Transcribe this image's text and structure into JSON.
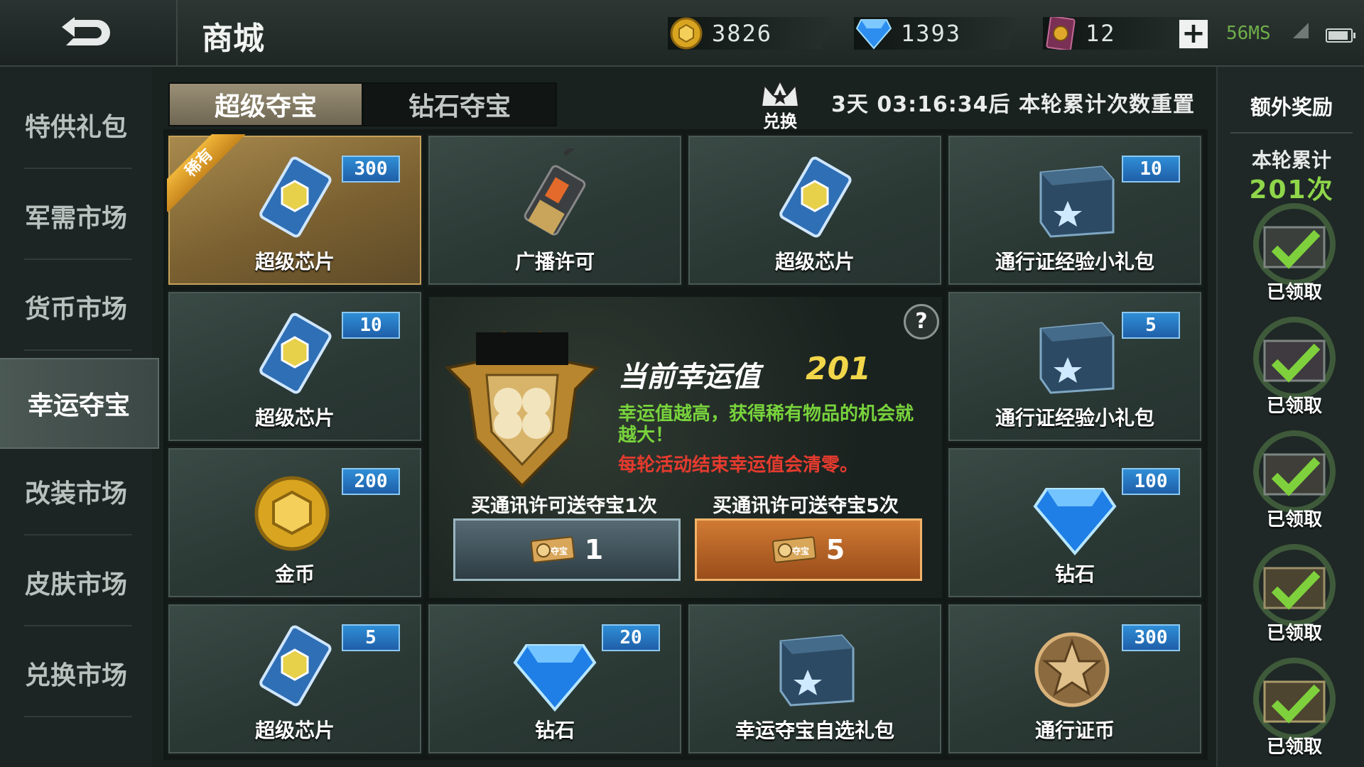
{
  "header": {
    "title": "商城",
    "gold": "3826",
    "diamonds": "1393",
    "passes": "12",
    "ping": "56MS"
  },
  "battery_level": 0.9,
  "sidebar": {
    "items": [
      {
        "label": "特供礼包"
      },
      {
        "label": "军需市场"
      },
      {
        "label": "货币市场"
      },
      {
        "label": "幸运夺宝"
      },
      {
        "label": "改装市场"
      },
      {
        "label": "皮肤市场"
      },
      {
        "label": "兑换市场"
      }
    ]
  },
  "tabs": {
    "super": "超级夺宝",
    "diamond": "钻石夺宝"
  },
  "exchange_label": "兑换",
  "reset_text": "3天 03:16:34后 本轮累计次数重置",
  "items": [
    {
      "name": "超级芯片",
      "count": "300",
      "rare": "稀有"
    },
    {
      "name": "广播许可",
      "count": ""
    },
    {
      "name": "超级芯片",
      "count": ""
    },
    {
      "name": "通行证经验小礼包",
      "count": "10"
    },
    {
      "name": "超级芯片",
      "count": "10"
    },
    {
      "name": "通行证经验小礼包",
      "count": "5"
    },
    {
      "name": "金币",
      "count": "200"
    },
    {
      "name": "钻石",
      "count": "100"
    },
    {
      "name": "超级芯片",
      "count": "5"
    },
    {
      "name": "钻石",
      "count": "20"
    },
    {
      "name": "幸运夺宝自选礼包",
      "count": ""
    },
    {
      "name": "通行证币",
      "count": "300"
    }
  ],
  "lucky": {
    "title": "当前幸运值",
    "value": "201",
    "desc": "幸运值越高，获得稀有物品的机会就越大！",
    "warning": "每轮活动结束幸运值会清零。",
    "buy1_label": "买通讯许可送夺宝1次",
    "buy5_label": "买通讯许可送夺宝5次",
    "buy1_count": "1",
    "buy5_count": "5",
    "ticket_text": "夺宝"
  },
  "bonus": {
    "title": "额外奖励",
    "round_label": "本轮累计",
    "round_value": "201次",
    "claimed": [
      "已领取",
      "已领取",
      "已领取",
      "已领取",
      "已领取"
    ]
  },
  "colors": {
    "accent_green": "#78d33c",
    "warning_red": "#e53b2e",
    "luck_yellow": "#f2d64a",
    "badge_blue": "#2f8ed6"
  }
}
